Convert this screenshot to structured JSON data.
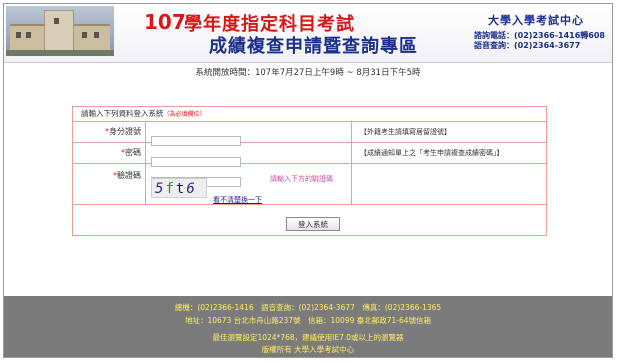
{
  "header": {
    "year": "107",
    "title_line1": "學年度指定科目考試",
    "title_line2": "成績複查申請暨查詢專區",
    "org_name": "大學入學考試中心",
    "query_phone": "諮詢電話：(02)2366-1416轉608",
    "voice_phone": "語音查詢：(02)2364-3677"
  },
  "system_time": "系統開放時間：107年7月27日上午9時 ~ 8月31日下午5時",
  "form": {
    "heading": "請輸入下列資料登入系統",
    "required_note": "（為必填欄位）",
    "id_label": "身分證號",
    "id_value": "",
    "id_hint": "【外籍考生請填寫居留證號】",
    "password_label": "密碼",
    "password_value": "",
    "password_hint": "【成績通知單上之「考生申請複查成績密碼」】",
    "captcha_label": "驗證碼",
    "captcha_value": "",
    "captcha_hint": "請輸入下方的驗證碼",
    "captcha_chars": [
      "5",
      "f",
      "t",
      "6"
    ],
    "refresh_link": "看不清楚換一下",
    "login_button": "登入系統"
  },
  "footer": {
    "line1": "總機：(02)2366-1416　語音查詢：(02)2364-3677　傳真：(02)2366-1365",
    "line2": "地址：10673 台北市舟山路237號　信箱：10099 臺北郵政71-64號信箱",
    "line3": "最佳瀏覽設定1024*768，建議使用IE7.0或以上的瀏覽器",
    "line4": "版權所有 大學入學考試中心"
  },
  "colors": {
    "title_red": "#d81818",
    "title_blue": "#1b2f8c",
    "panel_border": "#e2a28f",
    "footer_bg": "#7b7b7b",
    "footer_text": "#ffee66"
  }
}
